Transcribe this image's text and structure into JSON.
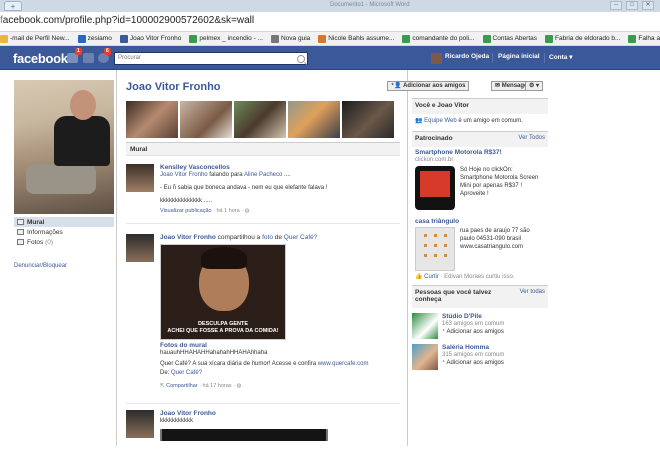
{
  "browser": {
    "window_title": "Documento1 - Microsoft Word",
    "url_main": "acebook.com/profile.php?id=100002900572602&sk=wall",
    "url_prefix_dim": "f",
    "bookmarks": [
      {
        "label": "-mail de Perfil New...",
        "color": "#e8b73a"
      },
      {
        "label": "zesiamo",
        "color": "#2b66c4"
      },
      {
        "label": "Joao Vitor Fronho",
        "color": "#3b5998"
      },
      {
        "label": "pelmex _ incendio - ...",
        "color": "#3a9a4e"
      },
      {
        "label": "Nova guia",
        "color": "#777777"
      },
      {
        "label": "Nicole Bahls assume...",
        "color": "#d8772b"
      },
      {
        "label": "comandante do poli...",
        "color": "#3a9a4e"
      },
      {
        "label": "Contas Abertas",
        "color": "#3a9a4e"
      },
      {
        "label": "Fabria de eldorado b...",
        "color": "#3a9a4e"
      },
      {
        "label": "Falha ao",
        "color": "#3a9a4e"
      }
    ]
  },
  "fbbar": {
    "logo": "facebook",
    "badge_friends": "1",
    "badge_notifications": "6",
    "search_placeholder": "Procurar",
    "user_name": "Ricardo Ojeda",
    "home_label": "Página inicial",
    "account_label": "Conta"
  },
  "profile": {
    "name": "Joao Vitor Fronho",
    "add_friend": "Adicionar aos amigos",
    "message": "Mensagem",
    "settings_glyph": "⚙ ▾",
    "nav": [
      {
        "label": "Mural"
      },
      {
        "label": "Informações"
      },
      {
        "label": "Fotos",
        "count": "(0)"
      }
    ],
    "report": "Denunciar/Bloquear"
  },
  "mural_header": "Mural",
  "posts": [
    {
      "author": "Kenslley Vasconcellos",
      "line2_a": "Joao Vitor Fronho",
      "line2_b": " falando para ",
      "line2_c": "Aline Pacheco",
      "line2_d": " ....",
      "text1": "- Eu ñ sabia que boneca andava - nem eu que elefante falava !",
      "text2": "kkkkkkkkkkkkkk .....",
      "meta_link": "Visualizar publicação",
      "meta_rest": " · há 1 hora · "
    },
    {
      "author": "Joao Vitor Fronho",
      "rest_a": " compartilhou a ",
      "rest_link1": "foto",
      "rest_b": " de ",
      "rest_link2": "Quer Café?",
      "photo_caption1": "DESCULPA GENTE",
      "photo_caption2": "ACHEI QUE FOSSE A PROVA DA COMIDA!",
      "album": "Fotos do mural",
      "text1": "hauauhHHAHAHHahahahHHAHAhhaha",
      "text2": "Quer Café? A sua xícara diária de humor! Acesse e confira ",
      "text2_link": "www.quercafe.com",
      "text3": "De: ",
      "text3_link": "Quer Café?",
      "meta_link": "Compartilhar",
      "meta_rest": " · há 17 horas · "
    },
    {
      "author": "Joao Vitor Fronho",
      "text1": "kkkkkkkkkkk"
    }
  ],
  "right": {
    "you_and": "Você e Joao Vitor",
    "mutual_link": "Equipe Web",
    "mutual_rest": " é um amigo em comum.",
    "sponsored": "Patrocinado",
    "see_all": "Ver Todos",
    "ad1_title": "Smartphone Motorola R$37!",
    "ad1_domain": "clickon.com.br",
    "ad1_text": "Só Hoje no clickOn: Smartphone Motorola Screen Mini por apenas R$37 ! Aproveite !",
    "ad2_title": "casa triângulo",
    "ad2_text": "rua paes de araujo 77 são paulo 04531-090 brasil www.casatriangulo.com",
    "ad2_like_link": "Curtir",
    "ad2_like_rest": " · Edivan Moraes curtiu isso.",
    "pymk": "Pessoas que você talvez conheça",
    "pymk_see_all": "Ver todas",
    "people": [
      {
        "name": "Stúdio D'Pile",
        "mutual": "163 amigos em comum",
        "add": "Adicionar aos amigos"
      },
      {
        "name": "Saléria Homma",
        "mutual": "315 amigos em comum",
        "add": "Adicionar aos amigos"
      }
    ]
  }
}
